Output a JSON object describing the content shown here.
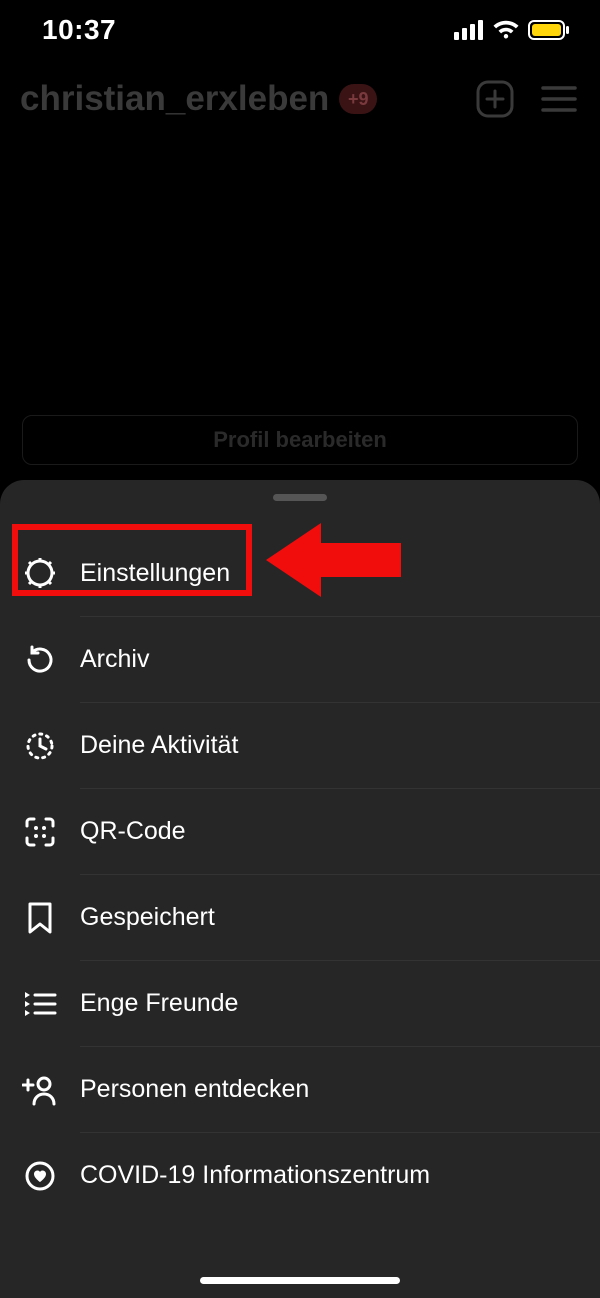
{
  "status": {
    "time": "10:37"
  },
  "header": {
    "username": "christian_erxleben",
    "notif_badge": "+9"
  },
  "edit_profile_label": "Profil bearbeiten",
  "menu": {
    "items": [
      {
        "label": "Einstellungen"
      },
      {
        "label": "Archiv"
      },
      {
        "label": "Deine Aktivität"
      },
      {
        "label": "QR-Code"
      },
      {
        "label": "Gespeichert"
      },
      {
        "label": "Enge Freunde"
      },
      {
        "label": "Personen entdecken"
      },
      {
        "label": "COVID-19 Informationszentrum"
      }
    ]
  }
}
